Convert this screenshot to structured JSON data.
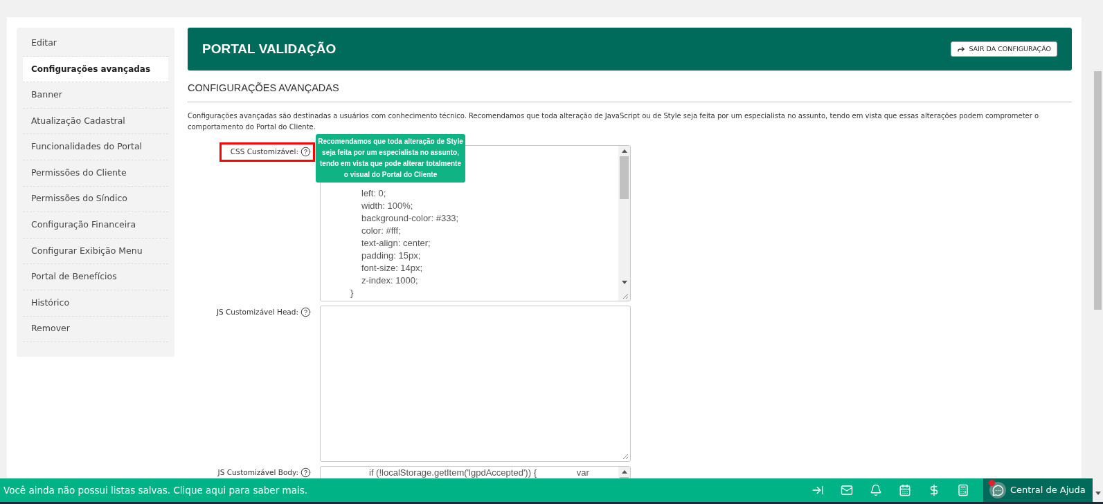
{
  "sidebar": {
    "items": [
      {
        "label": "Editar",
        "selected": false
      },
      {
        "label": "Configurações avançadas",
        "selected": true
      },
      {
        "label": "Banner",
        "selected": false
      },
      {
        "label": "Atualização Cadastral",
        "selected": false
      },
      {
        "label": "Funcionalidades do Portal",
        "selected": false
      },
      {
        "label": "Permissões do Cliente",
        "selected": false
      },
      {
        "label": "Permissões do Síndico",
        "selected": false
      },
      {
        "label": "Configuração Financeira",
        "selected": false
      },
      {
        "label": "Configurar Exibição Menu",
        "selected": false
      },
      {
        "label": "Portal de Benefícios",
        "selected": false
      },
      {
        "label": "Histórico",
        "selected": false
      },
      {
        "label": "Remover",
        "selected": false
      }
    ]
  },
  "header": {
    "title": "PORTAL VALIDAÇÃO",
    "exit_button": "SAIR DA CONFIGURAÇÃO"
  },
  "section_title": "CONFIGURAÇÕES AVANÇADAS",
  "description": "Configurações avançadas são destinadas a usuários com conhecimento técnico. Recomendamos que toda alteração de JavaScript ou de Style seja feita por um especialista no assunto, tendo em vista que essas alterações podem comprometer o comportamento do Portal do Cliente.",
  "fields": [
    {
      "label": "CSS Customizável:",
      "highlighted": true,
      "tooltip": "Recomendamos que toda alteração de Style seja feita por um especialista no assunto, tendo em vista que pode alterar totalmente o visual do Portal do Cliente",
      "lines": [
        {
          "kind": "property",
          "text": "left: 0;"
        },
        {
          "kind": "property",
          "text": "width: 100%;"
        },
        {
          "kind": "property",
          "text": "background-color: #333;"
        },
        {
          "kind": "property",
          "text": "color: #fff;"
        },
        {
          "kind": "property",
          "text": "text-align: center;"
        },
        {
          "kind": "property",
          "text": "padding: 15px;"
        },
        {
          "kind": "property",
          "text": "font-size: 14px;"
        },
        {
          "kind": "property",
          "text": "z-index: 1000;"
        },
        {
          "kind": "brace",
          "text": "}"
        }
      ]
    },
    {
      "label": "JS Customizável Head:",
      "highlighted": false
    },
    {
      "label": "JS Customizável Body:",
      "highlighted": false,
      "lines": [
        {
          "kind": "statement",
          "text": "if (!localStorage.getItem('lgpdAccepted')) {                var"
        }
      ]
    }
  ],
  "bottom_bar": {
    "message": "Você ainda não possui listas salvas. Clique aqui para saber mais.",
    "help": "Central de Ajuda",
    "help_notification": true
  }
}
